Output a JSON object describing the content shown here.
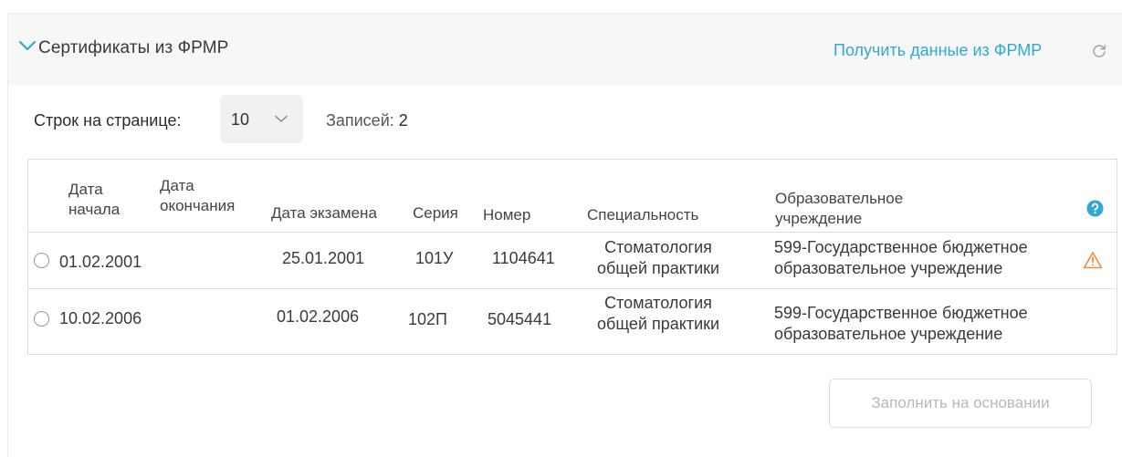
{
  "section": {
    "title": "Сертификаты из ФРМР",
    "fetch_link": "Получить данные из ФРМР",
    "accent_color": "#2fa8d4",
    "icons": {
      "toggle": "chevron-down-icon",
      "refresh": "refresh-icon"
    }
  },
  "pagination": {
    "rows_label": "Строк на странице:",
    "rows_value": "10",
    "records_label": "Записей:",
    "records_count": "2"
  },
  "table": {
    "columns": {
      "start_date": [
        "Дата",
        "начала"
      ],
      "end_date": [
        "Дата",
        "окончания"
      ],
      "exam_date": "Дата экзамена",
      "series": "Серия",
      "number": "Номер",
      "specialty": "Специальность",
      "institution": [
        "Образовательное",
        "учреждение"
      ]
    },
    "help_icon": "question-circle-icon",
    "rows": [
      {
        "start_date": "01.02.2001",
        "end_date": "",
        "exam_date": "25.01.2001",
        "series": "101У",
        "number": "1104641",
        "specialty": [
          "Стоматология",
          "общей практики"
        ],
        "institution": [
          "599-Государственное бюджетное",
          "образовательное учреждение"
        ],
        "warning_icon": "warning-triangle-icon",
        "warning_color": "#f08a3c"
      },
      {
        "start_date": "10.02.2006",
        "end_date": "",
        "exam_date": "01.02.2006",
        "series": "102П",
        "number": "5045441",
        "specialty": [
          "Стоматология",
          "общей практики"
        ],
        "institution": [
          "599-Государственное бюджетное",
          "образовательное учреждение"
        ]
      }
    ]
  },
  "actions": {
    "fill_button": "Заполнить на основании"
  }
}
